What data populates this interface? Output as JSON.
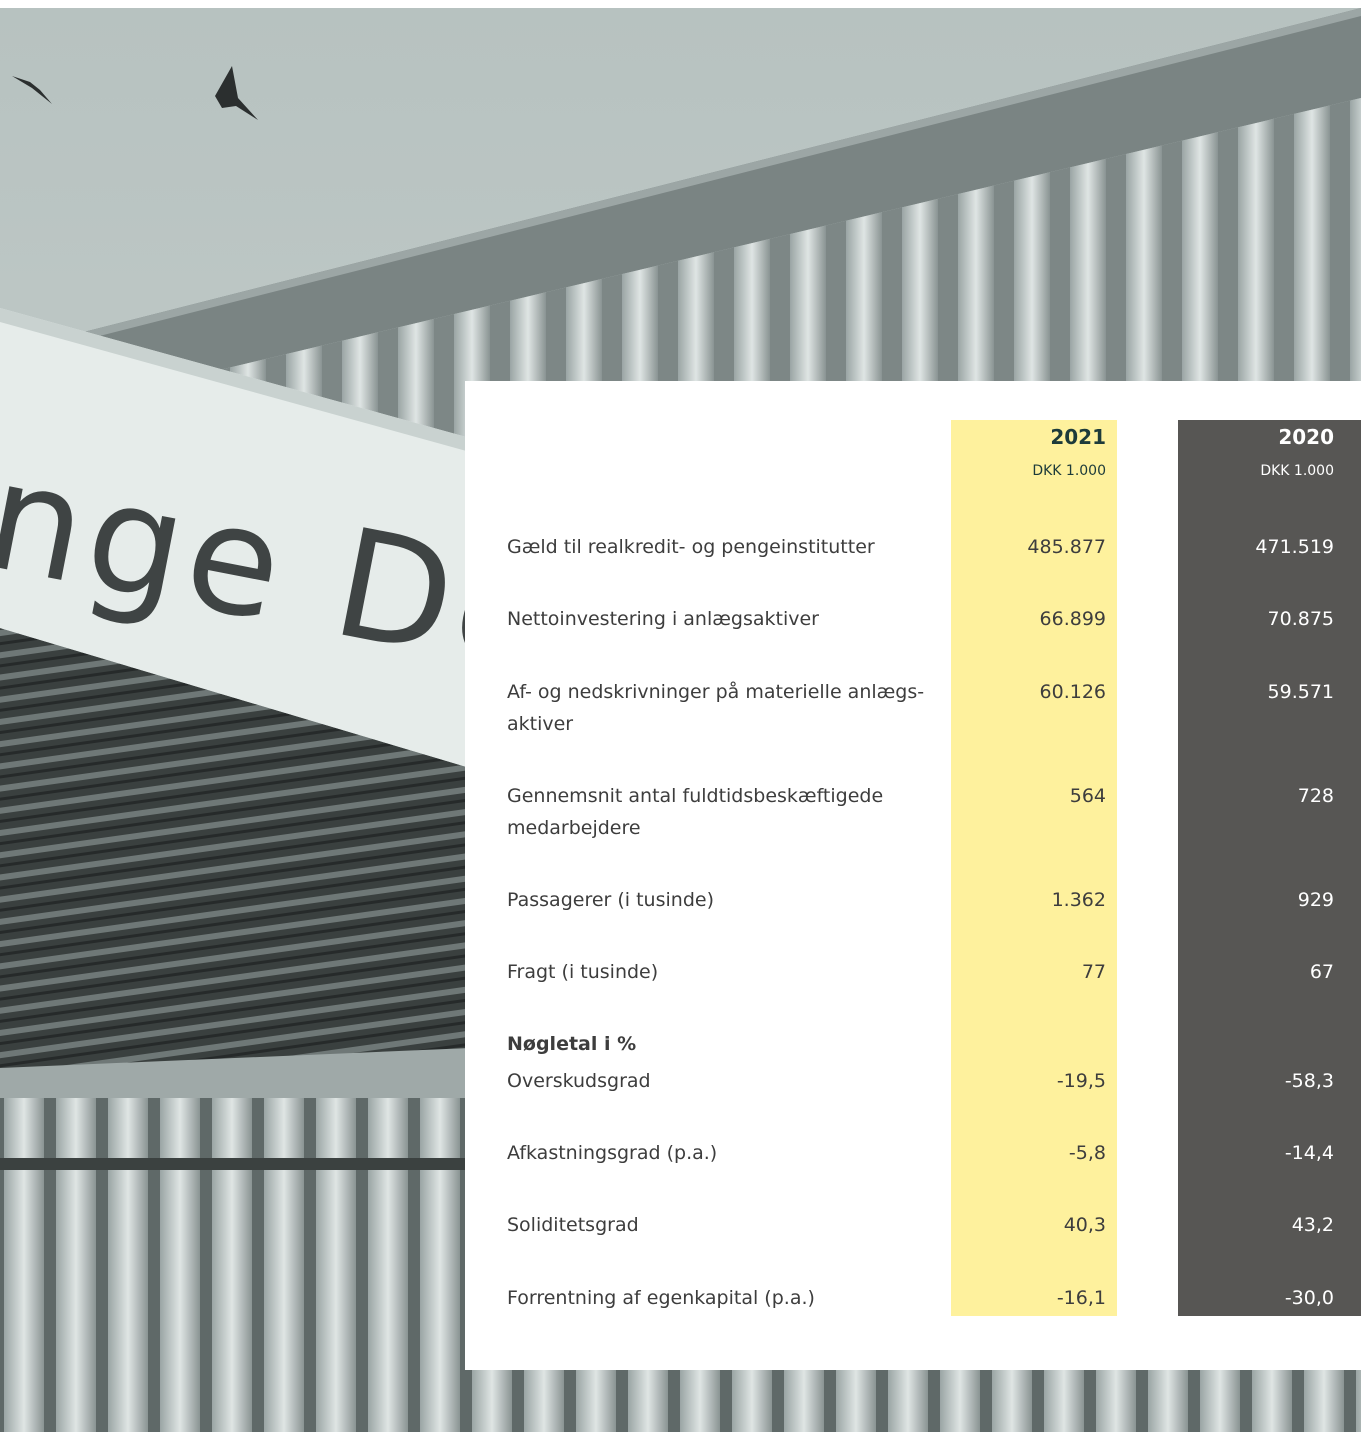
{
  "photo": {
    "sign_text": "nge De"
  },
  "table": {
    "col_2021": {
      "year": "2021",
      "unit": "DKK 1.000"
    },
    "col_2020": {
      "year": "2020",
      "unit": "DKK 1.000"
    },
    "rows": [
      {
        "label": "Gæld til realkredit- og pengeinstitutter",
        "v2021": "485.877",
        "v2020": "471.519"
      },
      {
        "label": "Nettoinvestering i anlægsaktiver",
        "v2021": "66.899",
        "v2020": "70.875"
      },
      {
        "label_line1": "Af- og nedskrivninger på materielle anlægs-",
        "label_line2": "aktiver",
        "v2021": "60.126",
        "v2020": "59.571"
      },
      {
        "label_line1": "Gennemsnit antal fuldtidsbeskæftigede",
        "label_line2": "medarbejdere",
        "v2021": "564",
        "v2020": "728"
      },
      {
        "label": "Passagerer (i tusinde)",
        "v2021": "1.362",
        "v2020": "929"
      },
      {
        "label": "Fragt (i tusinde)",
        "v2021": "77",
        "v2020": "67"
      },
      {
        "label": "Overskudsgrad",
        "v2021": "-19,5",
        "v2020": "-58,3"
      },
      {
        "label": "Afkastningsgrad (p.a.)",
        "v2021": "-5,8",
        "v2020": "-14,4"
      },
      {
        "label": "Soliditetsgrad",
        "v2021": "40,3",
        "v2020": "43,2"
      },
      {
        "label": "Forrentning af egenkapital (p.a.)",
        "v2021": "-16,1",
        "v2020": "-30,0"
      }
    ],
    "section_heading": "Nøgletal i %"
  },
  "colors": {
    "highlight_2021": "#fef19d",
    "dark_2020": "#575654",
    "year_2021_text": "#1d3b3a"
  }
}
